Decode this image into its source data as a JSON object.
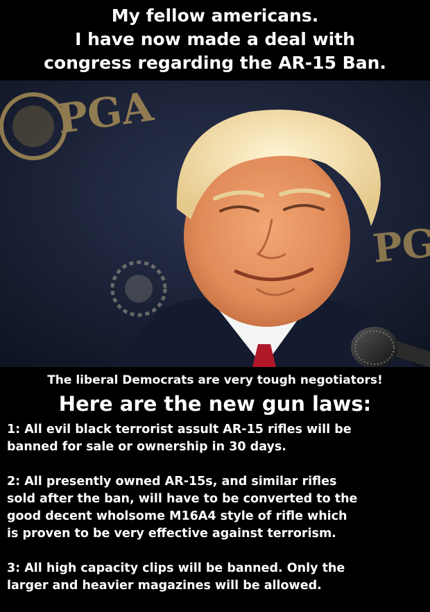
{
  "top_caption": {
    "lines": [
      "My fellow americans.",
      "I have now made a deal with",
      "congress regarding the AR-15 Ban."
    ]
  },
  "photo": {
    "background_logo_text": "PGA",
    "background_logo_text_right": "PG"
  },
  "subcaption": "The liberal Democrats are very tough negotiators!",
  "heading": "Here are the new gun laws:",
  "laws": [
    {
      "lines": [
        "1:  All evil black terrorist assult AR-15 rifles will be",
        "banned for sale or ownership in 30 days."
      ]
    },
    {
      "lines": [
        "2:  All presently owned AR-15s, and similar rifles",
        "sold after the ban, will have to be converted to the",
        "good decent wholsome M16A4 style of rifle which",
        "is proven to be very effective against terrorism."
      ]
    },
    {
      "lines": [
        "3:  All high capacity clips will be banned.  Only the",
        "larger and heavier magazines will be allowed."
      ]
    }
  ],
  "colors": {
    "background": "#000000",
    "text": "#ffffff",
    "photo_backdrop": "#1b2235",
    "logo_gold": "#b89a5a"
  }
}
